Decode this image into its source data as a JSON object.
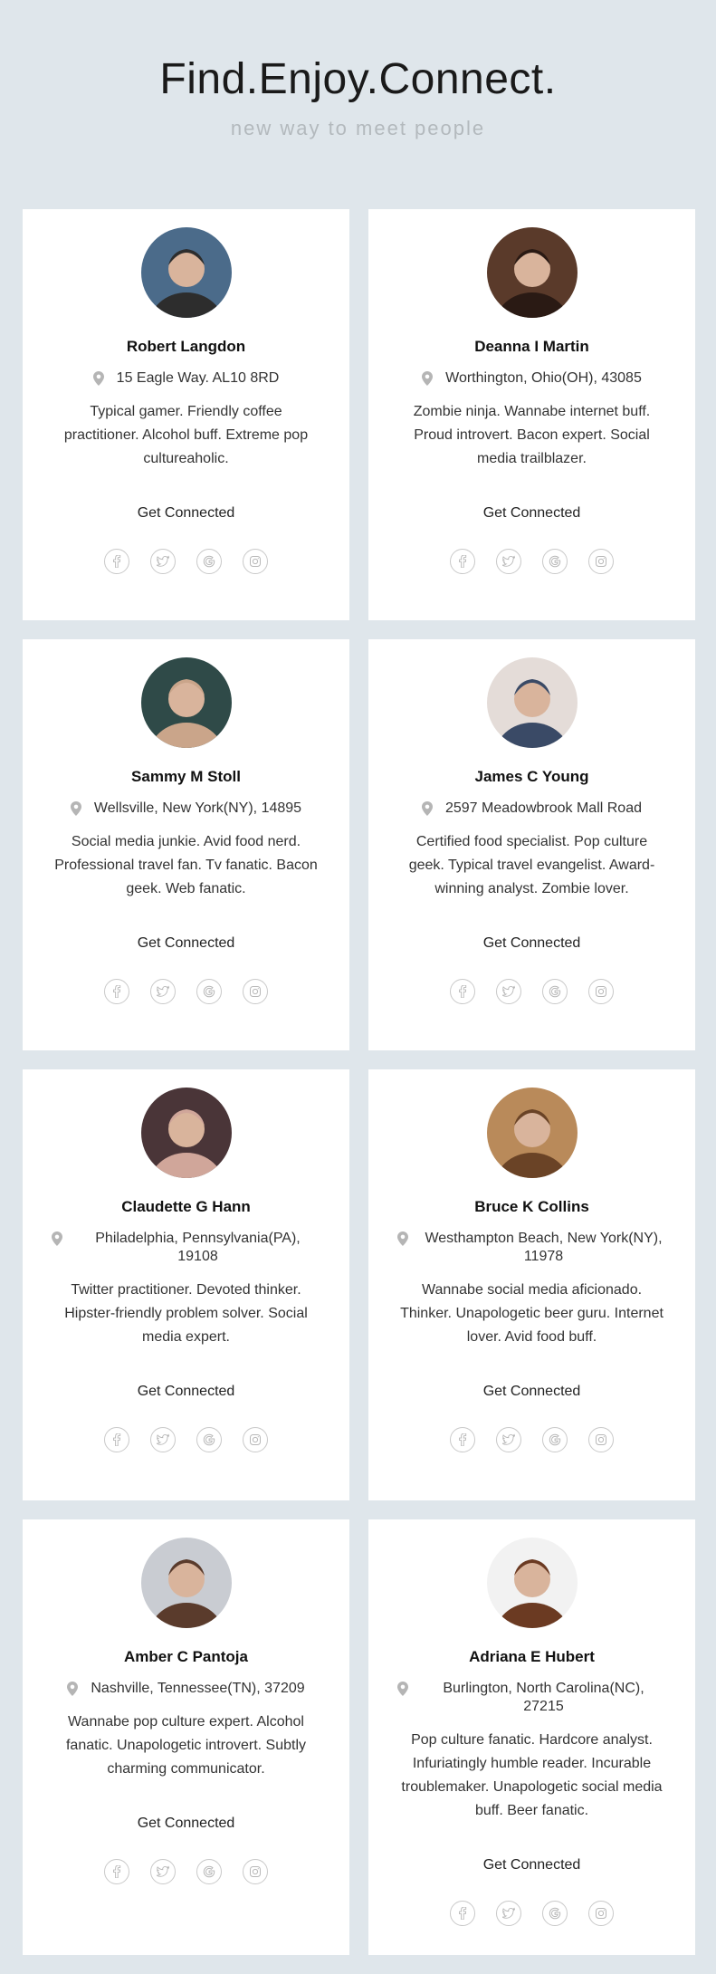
{
  "header": {
    "title": "Find.Enjoy.Connect.",
    "subtitle": "new way to meet people"
  },
  "cards": [
    {
      "name": "Robert Langdon",
      "location": "15 Eagle Way. AL10 8RD",
      "bio": "Typical gamer. Friendly coffee practitioner. Alcohol buff. Extreme pop cultureaholic.",
      "connect_label": "Get Connected",
      "avatar_bg": "#4b6b8a",
      "avatar_fg": "#2d2d2d"
    },
    {
      "name": "Deanna I Martin",
      "location": "Worthington, Ohio(OH), 43085",
      "bio": "Zombie ninja. Wannabe internet buff. Proud introvert. Bacon expert. Social media trailblazer.",
      "connect_label": "Get Connected",
      "avatar_bg": "#5a3a2a",
      "avatar_fg": "#2a1a14"
    },
    {
      "name": "Sammy M Stoll",
      "location": "Wellsville, New York(NY), 14895",
      "bio": "Social media junkie. Avid food nerd. Professional travel fan. Tv fanatic. Bacon geek. Web fanatic.",
      "connect_label": "Get Connected",
      "avatar_bg": "#2f4a48",
      "avatar_fg": "#caa58a"
    },
    {
      "name": "James C Young",
      "location": "2597 Meadowbrook Mall Road",
      "bio": "Certified food specialist. Pop culture geek. Typical travel evangelist. Award-winning analyst. Zombie lover.",
      "connect_label": "Get Connected",
      "avatar_bg": "#e4dcd8",
      "avatar_fg": "#3a4a66"
    },
    {
      "name": "Claudette G Hann",
      "location": "Philadelphia, Pennsylvania(PA), 19108",
      "bio": "Twitter practitioner. Devoted thinker. Hipster-friendly problem solver. Social media expert.",
      "connect_label": "Get Connected",
      "avatar_bg": "#4a3538",
      "avatar_fg": "#d0a69a"
    },
    {
      "name": "Bruce K Collins",
      "location": "Westhampton Beach, New York(NY), 11978",
      "bio": "Wannabe social media aficionado. Thinker. Unapologetic beer guru. Internet lover. Avid food buff.",
      "connect_label": "Get Connected",
      "avatar_bg": "#b98a5a",
      "avatar_fg": "#6a4326"
    },
    {
      "name": "Amber C Pantoja",
      "location": "Nashville, Tennessee(TN), 37209",
      "bio": "Wannabe pop culture expert. Alcohol fanatic. Unapologetic introvert. Subtly charming communicator.",
      "connect_label": "Get Connected",
      "avatar_bg": "#c9ccd2",
      "avatar_fg": "#5a3b2c"
    },
    {
      "name": "Adriana E Hubert",
      "location": "Burlington, North Carolina(NC), 27215",
      "bio": "Pop culture fanatic. Hardcore analyst. Infuriatingly humble reader. Incurable troublemaker. Unapologetic social media buff. Beer fanatic.",
      "connect_label": "Get Connected",
      "avatar_bg": "#f2f2f2",
      "avatar_fg": "#6b3a22"
    }
  ],
  "socials": [
    "facebook-icon",
    "twitter-icon",
    "google-icon",
    "instagram-icon"
  ]
}
